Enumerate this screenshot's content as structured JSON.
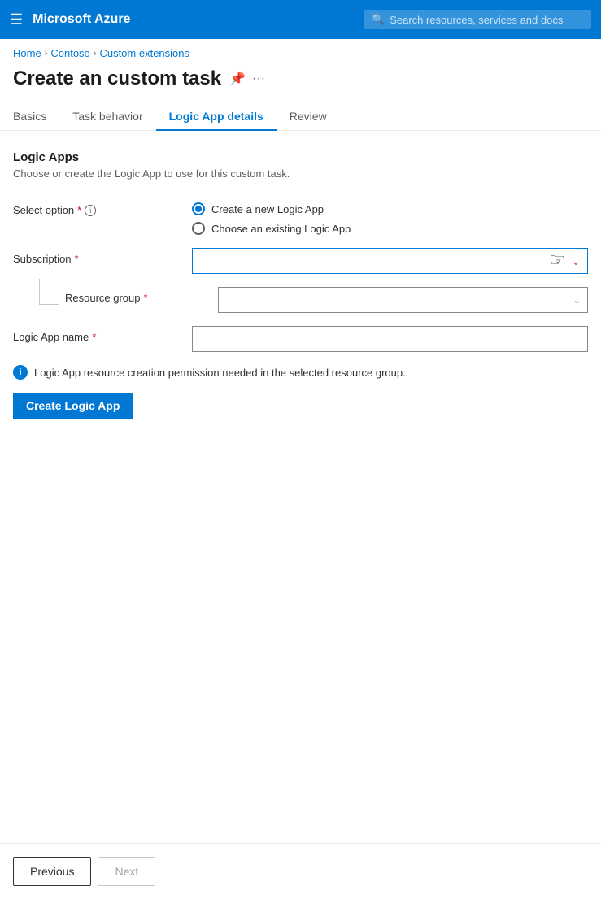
{
  "topnav": {
    "title": "Microsoft Azure",
    "search_placeholder": "Search resources, services and docs"
  },
  "breadcrumb": {
    "items": [
      "Home",
      "Contoso",
      "Custom extensions"
    ]
  },
  "page": {
    "title": "Create an custom task",
    "pin_icon": "📌",
    "more_icon": "···"
  },
  "tabs": [
    {
      "label": "Basics",
      "active": false
    },
    {
      "label": "Task behavior",
      "active": false
    },
    {
      "label": "Logic App details",
      "active": true
    },
    {
      "label": "Review",
      "active": false
    }
  ],
  "section": {
    "title": "Logic Apps",
    "description": "Choose or create the Logic App to use for this custom task."
  },
  "form": {
    "select_option_label": "Select option",
    "radio_create": "Create a new Logic App",
    "radio_existing": "Choose an existing Logic App",
    "subscription_label": "Subscription",
    "resource_group_label": "Resource group",
    "logic_app_name_label": "Logic App name",
    "info_message": "Logic App resource creation permission needed in the selected resource group.",
    "create_button": "Create Logic App"
  },
  "footer": {
    "previous_label": "Previous",
    "next_label": "Next"
  }
}
